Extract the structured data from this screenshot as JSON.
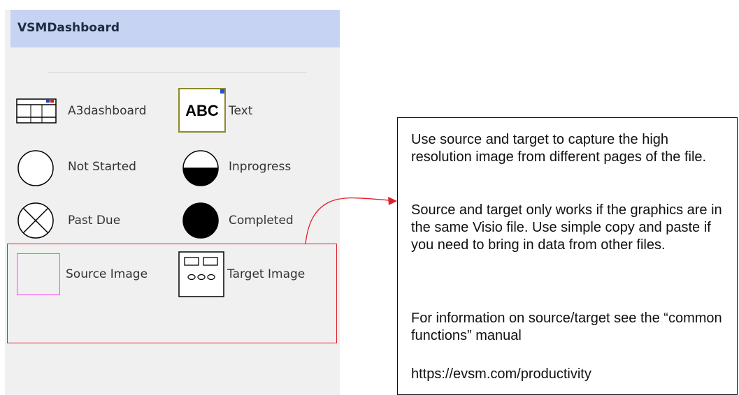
{
  "panel": {
    "title": "VSMDashboard",
    "items": [
      {
        "label": "A3dashboard",
        "icon": "dashboard-icon"
      },
      {
        "label": "Text",
        "icon": "text-abc-icon"
      },
      {
        "label": "Not Started",
        "icon": "empty-circle-icon"
      },
      {
        "label": "Inprogress",
        "icon": "half-filled-circle-icon"
      },
      {
        "label": "Past Due",
        "icon": "x-circle-icon"
      },
      {
        "label": "Completed",
        "icon": "filled-circle-icon"
      },
      {
        "label": "Source Image",
        "icon": "source-image-icon"
      },
      {
        "label": "Target Image",
        "icon": "target-image-icon"
      }
    ],
    "text_icon_glyph": "ABC"
  },
  "callout": {
    "paragraphs": [
      "Use source and target to capture the high resolution image from different pages of the file.",
      "Source and target only works if the graphics are in the same Visio file. Use simple copy and paste if you need to bring in data from other files.",
      "For information on source/target see the “common functions” manual",
      "https://evsm.com/productivity"
    ]
  },
  "colors": {
    "header_bg": "#c7d3f2",
    "panel_bg": "#f0f0f0",
    "highlight": "#e0202a",
    "source_image_border": "#ff3cff",
    "text_icon_border": "#8b8b2a"
  }
}
